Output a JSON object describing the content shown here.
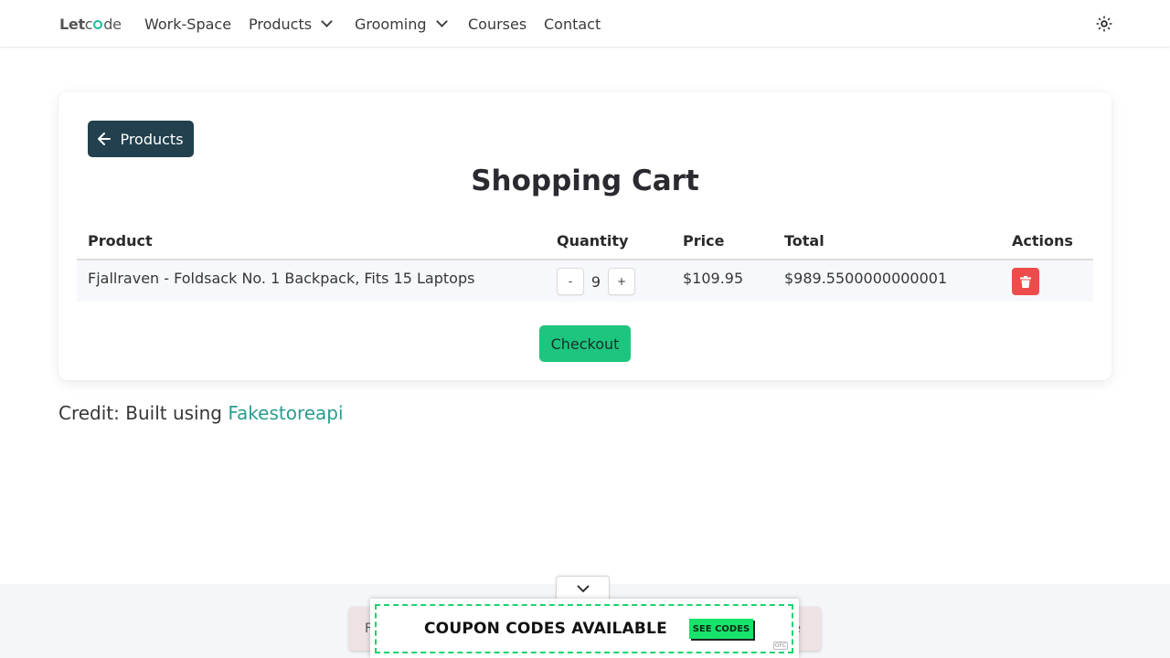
{
  "navbar": {
    "brand": {
      "part1": "Let",
      "part2": "c",
      "part3": "de"
    },
    "items": [
      {
        "label": "Work-Space"
      },
      {
        "label": "Products",
        "has_dropdown": true
      },
      {
        "label": "Grooming",
        "has_dropdown": true
      },
      {
        "label": "Courses"
      },
      {
        "label": "Contact"
      }
    ],
    "theme_icon": "sun-icon"
  },
  "cart": {
    "back_label": "Products",
    "title": "Shopping Cart",
    "columns": [
      "Product",
      "Quantity",
      "Price",
      "Total",
      "Actions"
    ],
    "rows": [
      {
        "product": "Fjallraven - Foldsack No. 1 Backpack, Fits 15 Laptops",
        "decrement": "-",
        "quantity": "9",
        "increment": "+",
        "price": "$109.95",
        "total": "$989.5500000000001",
        "action_icon": "trash-icon"
      }
    ],
    "checkout_label": "Checkout"
  },
  "credit": {
    "prefix": "Credit: Built using ",
    "link": "Fakestoreapi"
  },
  "ad": {
    "text": "COUPON CODES AVAILABLE",
    "cta": "SEE CODES",
    "mark": "GFC",
    "behind_left": "F",
    "behind_right": "e"
  },
  "colors": {
    "back_button": "#22404d",
    "checkout_button": "#1dc57f",
    "delete_button": "#ee4b4b",
    "link": "#2a9d8f",
    "ad_accent": "#17e26a"
  }
}
